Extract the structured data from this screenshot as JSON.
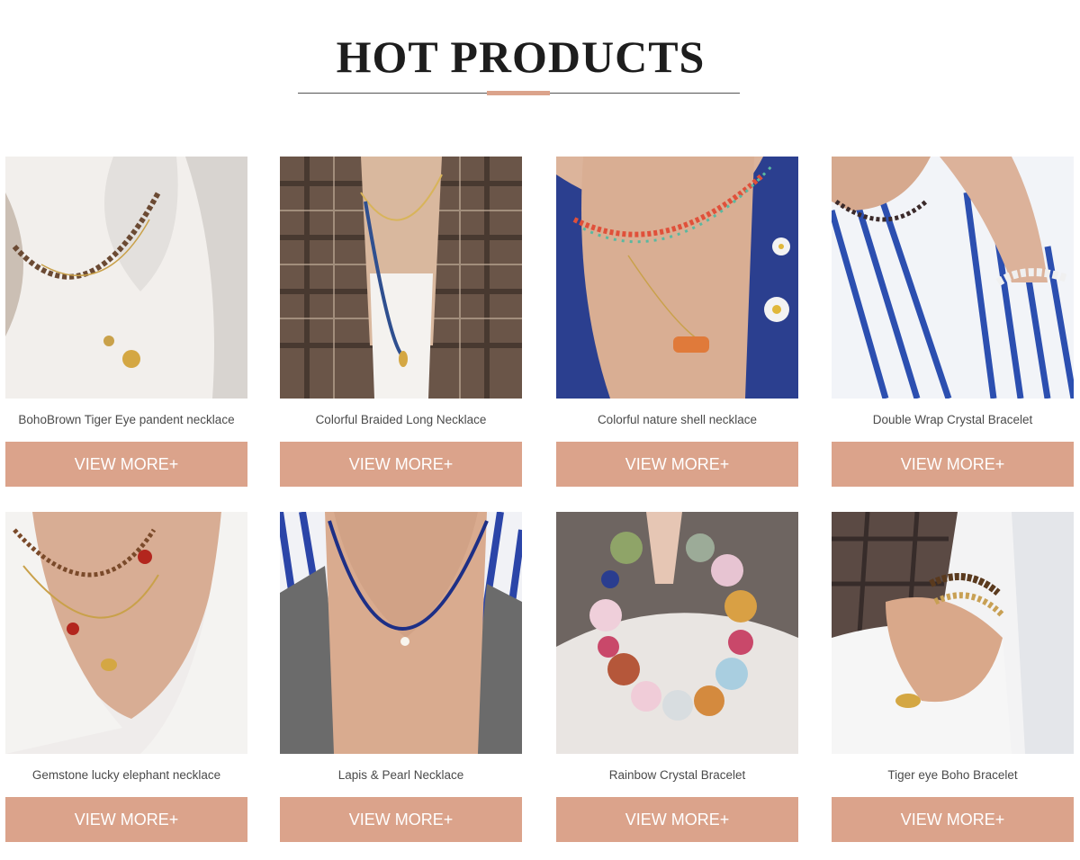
{
  "section": {
    "title": "HOT PRODUCTS",
    "accent_color": "#dba38b"
  },
  "products": [
    {
      "name": "BohoBrown Tiger Eye pandent necklace",
      "button": "VIEW MORE+",
      "image": "necklace-white-top-photo"
    },
    {
      "name": "Colorful Braided Long Necklace",
      "button": "VIEW MORE+",
      "image": "necklace-plaid-shirt-photo"
    },
    {
      "name": "Colorful nature shell necklace",
      "button": "VIEW MORE+",
      "image": "necklace-blue-daisy-photo"
    },
    {
      "name": "Double Wrap Crystal Bracelet",
      "button": "VIEW MORE+",
      "image": "bracelet-striped-shirt-photo"
    },
    {
      "name": "Gemstone lucky elephant necklace",
      "button": "VIEW MORE+",
      "image": "necklace-white-scoop-photo"
    },
    {
      "name": "Lapis & Pearl Necklace",
      "button": "VIEW MORE+",
      "image": "necklace-lapis-striped-photo"
    },
    {
      "name": "Rainbow Crystal Bracelet",
      "button": "VIEW MORE+",
      "image": "bracelet-crystal-hand-photo"
    },
    {
      "name": "Tiger eye Boho Bracelet",
      "button": "VIEW MORE+",
      "image": "bracelet-tiger-eye-photo"
    }
  ]
}
